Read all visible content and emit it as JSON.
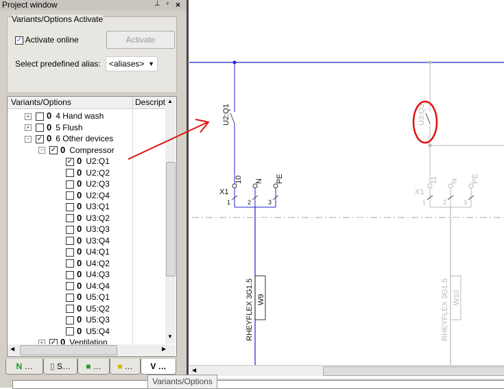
{
  "panel": {
    "title": "Project window",
    "pin_icon": "pin-icon",
    "menu_icon": "dropdown-icon",
    "close_icon": "close-icon"
  },
  "activation": {
    "group_title": "Variants/Options Activate",
    "activate_online_label": "Activate online",
    "activate_online_checked": true,
    "activate_button": "Activate",
    "alias_label": "Select predefined alias:",
    "alias_value": "<aliases>"
  },
  "tree": {
    "columns": [
      "Variants/Options",
      "Descriptic"
    ],
    "items": [
      {
        "label": "4 Hand wash",
        "level": 0,
        "expander": "+",
        "checked": false
      },
      {
        "label": "5 Flush",
        "level": 0,
        "expander": "+",
        "checked": false
      },
      {
        "label": "6 Other devices",
        "level": 0,
        "expander": "-",
        "checked": true
      },
      {
        "label": "Compressor",
        "level": 1,
        "expander": "-",
        "checked": true
      },
      {
        "label": "U2:Q1",
        "level": 2,
        "checked": true
      },
      {
        "label": "U2:Q2",
        "level": 2,
        "checked": false
      },
      {
        "label": "U2:Q3",
        "level": 2,
        "checked": false
      },
      {
        "label": "U2:Q4",
        "level": 2,
        "checked": false
      },
      {
        "label": "U3:Q1",
        "level": 2,
        "checked": false
      },
      {
        "label": "U3:Q2",
        "level": 2,
        "checked": false
      },
      {
        "label": "U3:Q3",
        "level": 2,
        "checked": false
      },
      {
        "label": "U3:Q4",
        "level": 2,
        "checked": false
      },
      {
        "label": "U4:Q1",
        "level": 2,
        "checked": false
      },
      {
        "label": "U4:Q2",
        "level": 2,
        "checked": false
      },
      {
        "label": "U4:Q3",
        "level": 2,
        "checked": false
      },
      {
        "label": "U4:Q4",
        "level": 2,
        "checked": false
      },
      {
        "label": "U5:Q1",
        "level": 2,
        "checked": false
      },
      {
        "label": "U5:Q2",
        "level": 2,
        "checked": false
      },
      {
        "label": "U5:Q3",
        "level": 2,
        "checked": false
      },
      {
        "label": "U5:Q4",
        "level": 2,
        "checked": false
      },
      {
        "label": "Ventilation",
        "level": 1,
        "expander": "+",
        "checked": true
      }
    ]
  },
  "tabs": [
    {
      "label": "…",
      "icon": "n-green-icon"
    },
    {
      "label": "S…",
      "icon": "pages-icon"
    },
    {
      "label": "…",
      "icon": "green-cube-icon"
    },
    {
      "label": "…",
      "icon": "yellow-cube-icon"
    },
    {
      "label": "V …",
      "icon": "",
      "active": true
    }
  ],
  "tooltip": "Variants/Options",
  "schematic": {
    "active": {
      "device": "U2:Q1",
      "terminal_strip": "X1",
      "terminals": [
        "10",
        "N",
        "PE"
      ],
      "pins": [
        "1",
        "2",
        "3"
      ],
      "cable_type": "RHEYFLEX 3G1.5",
      "cable": "W9",
      "color": "#2020d0"
    },
    "inactive": {
      "device": "U3:Q3",
      "terminal_strip": "X1",
      "terminals": [
        "11",
        "N",
        "PE"
      ],
      "pins": [
        "1",
        "2",
        "3"
      ],
      "cable_type": "RHEYFLEX 3G1.5",
      "cable": "W10",
      "color": "#b8b8b8"
    },
    "annotation_color": "#e01010"
  }
}
